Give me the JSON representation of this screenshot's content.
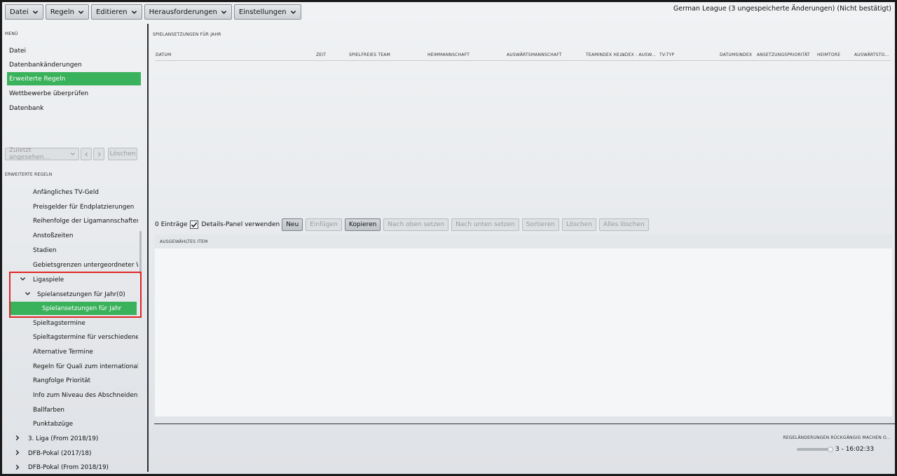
{
  "toolbar": {
    "menus": [
      {
        "label": "Datei"
      },
      {
        "label": "Regeln"
      },
      {
        "label": "Editieren"
      },
      {
        "label": "Herausforderungen"
      },
      {
        "label": "Einstellungen"
      }
    ],
    "app_title": "German League (3 ungespeicherte Änderungen) (Nicht bestätigt)"
  },
  "sidebar": {
    "menu_label": "MENÜ",
    "menu_items": [
      {
        "label": "Datei"
      },
      {
        "label": "Datenbankänderungen"
      },
      {
        "label": "Erweiterte Regeln",
        "active": true
      },
      {
        "label": "Wettbewerbe überprüfen"
      },
      {
        "label": "Datenbank"
      }
    ],
    "history": {
      "placeholder": "Zuletzt angesehen...",
      "clear_label": "Löschen"
    },
    "rules_label": "ERWEITERTE REGELN",
    "tree": [
      {
        "label": "Anfängliches TV-Geld"
      },
      {
        "label": "Preisgelder für Endplatzierungen"
      },
      {
        "label": "Reihenfolge der Ligamannschaften"
      },
      {
        "label": "Anstoßzeiten"
      },
      {
        "label": "Stadien"
      },
      {
        "label": "Gebietsgrenzen untergeordneter Wettbe"
      },
      {
        "label": "Ligaspiele"
      },
      {
        "label": "Spielansetzungen für Jahr(0)"
      },
      {
        "label": "Spielansetzungen für Jahr"
      },
      {
        "label": "Spieltagstermine"
      },
      {
        "label": "Spieltagstermine für verschiedene Jahre"
      },
      {
        "label": "Alternative Termine"
      },
      {
        "label": "Regeln für Quali zum internationalen We"
      },
      {
        "label": "Rangfolge Priorität"
      },
      {
        "label": "Info zum Niveau des Abschneidens"
      },
      {
        "label": "Ballfarben"
      },
      {
        "label": "Punktabzüge"
      },
      {
        "label": "3. Liga (From 2018/19)"
      },
      {
        "label": "DFB-Pokal (2017/18)"
      },
      {
        "label": "DFB-Pokal (From 2018/19)"
      }
    ]
  },
  "main": {
    "section_title": "SPIELANSETZUNGEN FÜR JAHR",
    "columns": [
      "DATUM",
      "ZEIT",
      "SPIELFREIES TEAM",
      "HEIMMANNSCHAFT",
      "AUSWÄRTSMANNSCHAFT",
      "TEAMINDEX HE...",
      "INDEX - AUSW...",
      "TV-TYP",
      "DATUMSINDEX",
      "ANSETZUNGSPRIORITÄT",
      "HEIMTORE",
      "AUSWÄRTSTO..."
    ],
    "entry_count": "0 Einträge",
    "details_checkbox_label": "Details-Panel verwenden",
    "details_checked": true,
    "buttons": {
      "new": "Neu",
      "insert": "Einfügen",
      "copy": "Kopieren",
      "move_up": "Nach oben setzen",
      "move_down": "Nach unten setzen",
      "sort": "Sortieren",
      "delete": "Löschen",
      "delete_all": "Alles löschen"
    },
    "details_title": "AUSGEWÄHLTES ITEM"
  },
  "undo": {
    "label": "REGELÄNDERUNGEN RÜCKGÄNGIG MACHEN O...",
    "value_text": "3 - 16:02:33",
    "slider_position": 1.0
  }
}
